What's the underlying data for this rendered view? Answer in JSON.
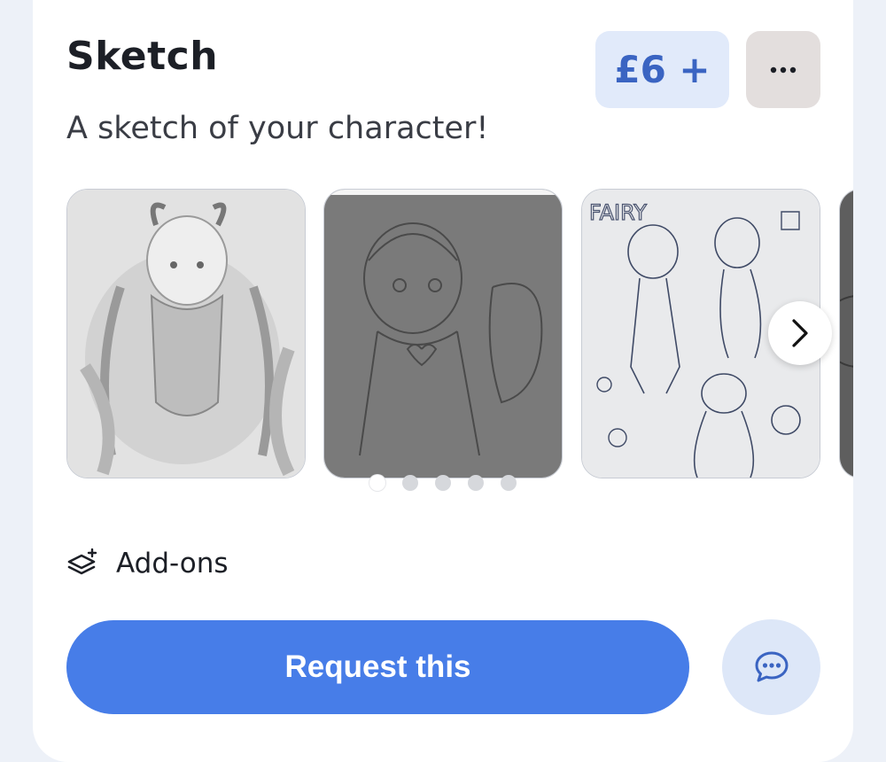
{
  "product": {
    "title": "Sketch",
    "price": "£6 +",
    "description": "A sketch of your character!"
  },
  "gallery": {
    "images": [
      {
        "alt": "grey-anime-dragon-girl-sketch"
      },
      {
        "alt": "dark-grey-hooded-girl-sketch"
      },
      {
        "alt": "blue-line-fairy-character-sheet"
      },
      {
        "alt": "partial-dark-sketch"
      }
    ],
    "page_count": 5,
    "active_page": 0
  },
  "addons": {
    "label": "Add-ons"
  },
  "actions": {
    "request_label": "Request this"
  },
  "icons": {
    "more": "more-horizontal-icon",
    "next": "chevron-right-icon",
    "addons": "layers-plus-icon",
    "chat": "chat-bubble-icon"
  },
  "colors": {
    "accent": "#477de8",
    "price_bg": "#e1eafa",
    "price_text": "#3a64c2",
    "chat_bg": "#dde7f8"
  }
}
